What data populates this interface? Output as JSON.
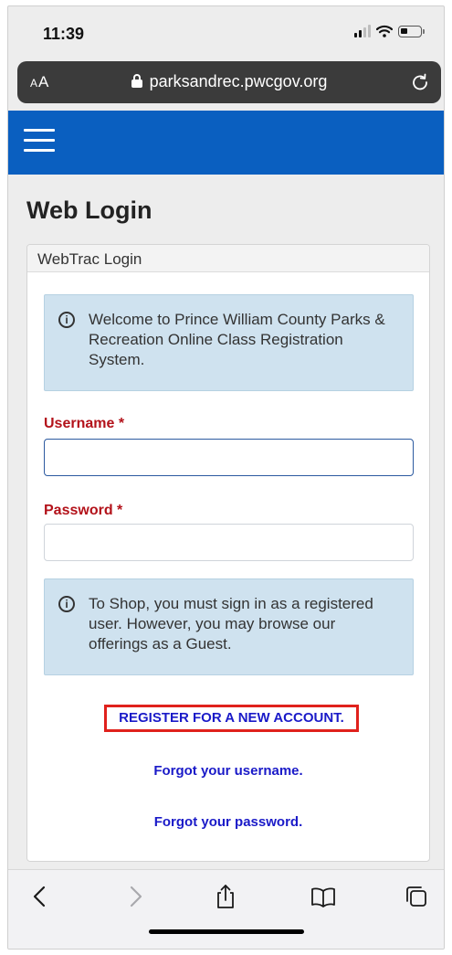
{
  "status_bar": {
    "time": "11:39"
  },
  "address_bar": {
    "aa_label_small": "A",
    "aa_label": "A",
    "url": "parksandrec.pwcgov.org"
  },
  "page": {
    "title": "Web Login",
    "card_header": "WebTrac Login",
    "welcome_message": "Welcome to Prince William County Parks & Recreation Online Class Registration System.",
    "username_label": "Username *",
    "username_value": "",
    "password_label": "Password *",
    "password_value": "",
    "shop_message": "To Shop, you must sign in as a registered user. However, you may browse our offerings as a Guest.",
    "register_link": "REGISTER FOR A NEW ACCOUNT.",
    "forgot_username_link": "Forgot your username.",
    "forgot_password_link": "Forgot your password."
  },
  "icons": {
    "info": "info-circle-icon",
    "menu": "hamburger-icon",
    "toolbar": [
      "back-icon",
      "forward-icon",
      "share-icon",
      "bookmarks-icon",
      "tabs-icon"
    ]
  },
  "colors": {
    "nav_blue": "#0a5fc0",
    "required_label": "#b3121a",
    "link_blue": "#1a1ac8",
    "highlight_red": "#e0211c",
    "info_bg": "#cfe2ef"
  }
}
